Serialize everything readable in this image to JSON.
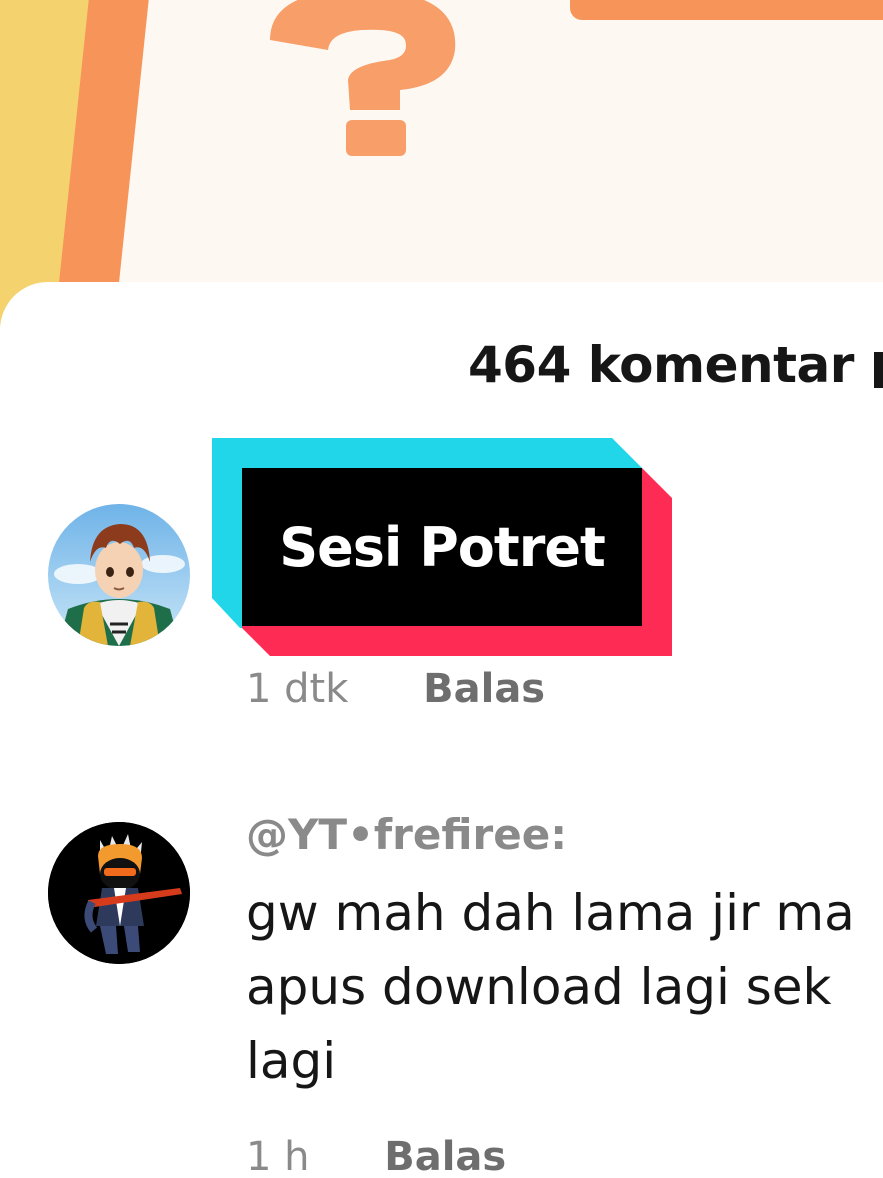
{
  "header": {
    "comment_count": "464 komentar"
  },
  "overlay": {
    "title": "Sesi Potret"
  },
  "comments": [
    {
      "avatar_icon": "anime-avatar-icon",
      "time": "1 dtk",
      "reply_label": "Balas"
    },
    {
      "avatar_icon": "gamer-avatar-icon",
      "username": "@YT•frefiree:",
      "text_lines": [
        "gw mah dah lama jir ma",
        "apus download lagi sek",
        "lagi"
      ],
      "time": "1 h",
      "reply_label": "Balas"
    }
  ],
  "colors": {
    "accent_cyan": "#21d6e9",
    "accent_pink": "#fe2c55",
    "thumb_orange": "#f7945a",
    "thumb_yellow": "#f4d36f"
  }
}
